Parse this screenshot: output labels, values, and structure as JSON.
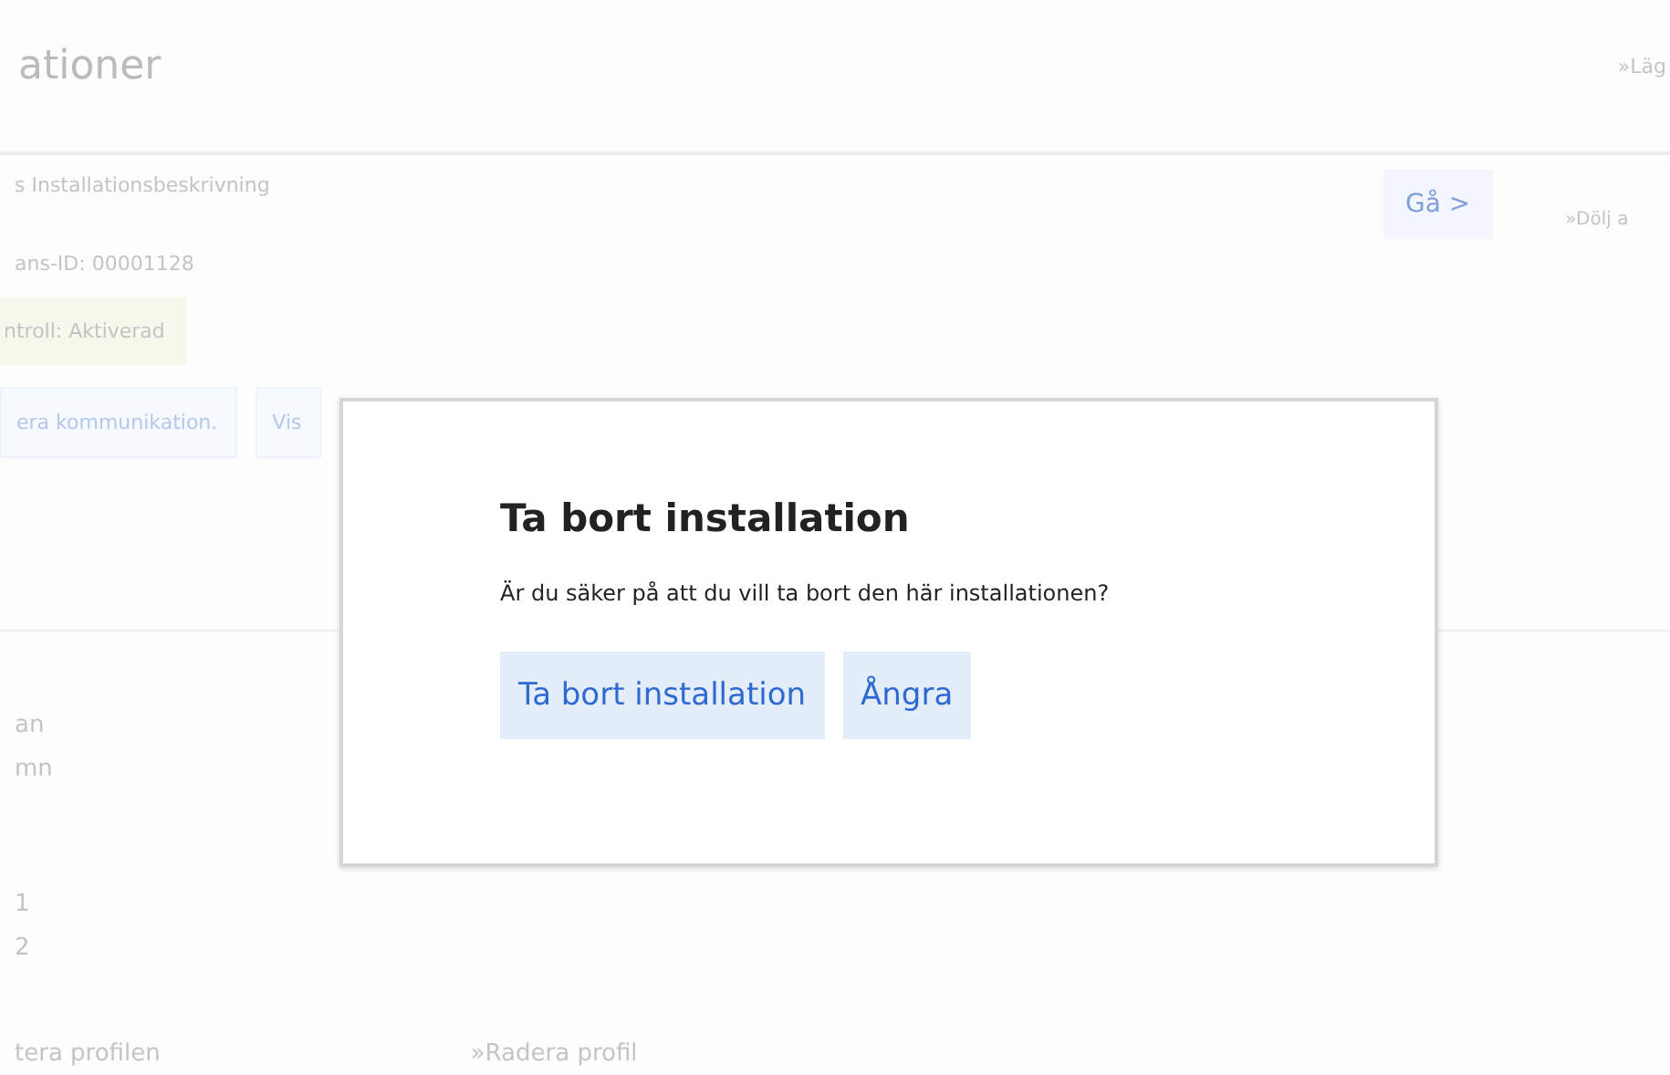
{
  "page": {
    "title": "ationer",
    "header_link": "»Läg",
    "description": "s Installationsbeskrivning",
    "installation_id": "ans-ID: 00001128",
    "status_badge": "ntroll: Aktiverad",
    "actions": [
      "era kommunikation.",
      "Vis"
    ],
    "go_button": "Gå >",
    "side_link": "»Dölj a",
    "details": [
      {
        "label": "an"
      },
      {
        "label": "mn"
      },
      {
        "label": "1"
      },
      {
        "label": "2"
      }
    ],
    "footer_links": [
      "tera profilen",
      "»Radera profil"
    ]
  },
  "dialog": {
    "title": "Ta bort installation",
    "message": "Är du säker på att du vill ta bort den här installationen?",
    "buttons": [
      "Ta bort installation",
      "Ångra"
    ]
  }
}
